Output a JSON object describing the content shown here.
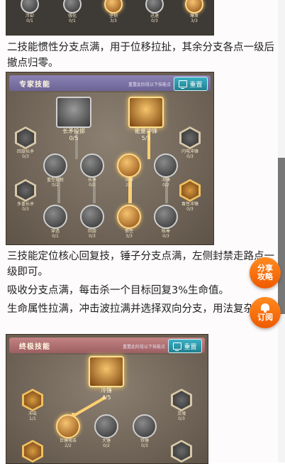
{
  "top_image": {
    "nodes": [
      {
        "label": "冷却",
        "count": "0/1"
      },
      {
        "label": "强化",
        "count": "0/1"
      },
      {
        "label": "坚韧",
        "count": "3/3"
      },
      {
        "label": "迅速",
        "count": "0/3"
      },
      {
        "label": "爆发",
        "count": "3/3"
      }
    ]
  },
  "paragraph_1": "二技能惯性分支点满，用于位移拉扯，其余分支各点一级后撤点归零。",
  "expert_skills": {
    "title": "专家技能",
    "hint": "重置此阶段以下技能点",
    "reset_label": "重置",
    "main_nodes": [
      {
        "label": "长矛投掷",
        "count": "0/5"
      },
      {
        "label": "能量冲锋",
        "count": "5/5"
      }
    ],
    "side_nodes": [
      {
        "label": "回旋长矛",
        "count": "0/3"
      },
      {
        "label": "闪电冲锋",
        "count": "0/3"
      },
      {
        "label": "多重长矛",
        "count": "0/3"
      },
      {
        "label": "毒性冲锋",
        "count": "0/3"
      }
    ],
    "row_nodes": [
      {
        "label": "重型投枪",
        "count": "0/2"
      },
      {
        "label": "长矛",
        "count": "0/2"
      },
      {
        "label": "冲锋",
        "count": "2/2"
      },
      {
        "label": "冲锋",
        "count": "0/2"
      }
    ],
    "bottom_nodes": [
      {
        "label": "穿透",
        "count": "0/1"
      },
      {
        "label": "回旋",
        "count": "0/3"
      },
      {
        "label": "惯性",
        "count": "3/3"
      },
      {
        "label": "眩晕",
        "count": "0/3"
      }
    ]
  },
  "paragraph_2": "三技能定位核心回复技，锤子分支点满，左侧封禁走路点一级即可。",
  "paragraph_3": "吸收分支点满，每击杀一个目标回复3%生命值。",
  "paragraph_4": "生命属性拉满，冲击波拉满并选择双向分支，用法复杂。",
  "ultimate_skills": {
    "title": "终极技能",
    "hint": "重置此阶段以下技能点",
    "reset_label": "重置",
    "main_node": {
      "label": "冷锤",
      "count": "4/5"
    },
    "side_nodes": [
      {
        "label": "冲击",
        "count": "1/1"
      },
      {
        "label": "灵魂",
        "count": "0/3"
      }
    ],
    "row_nodes": [
      {
        "label": "巨锤攻击",
        "count": "2/2"
      },
      {
        "label": "大锤",
        "count": "0/2"
      },
      {
        "label": "铁锤",
        "count": "0/3"
      }
    ]
  },
  "floating": {
    "share_label_1": "分享",
    "share_label_2": "攻略",
    "subscribe_label": "订阅"
  }
}
